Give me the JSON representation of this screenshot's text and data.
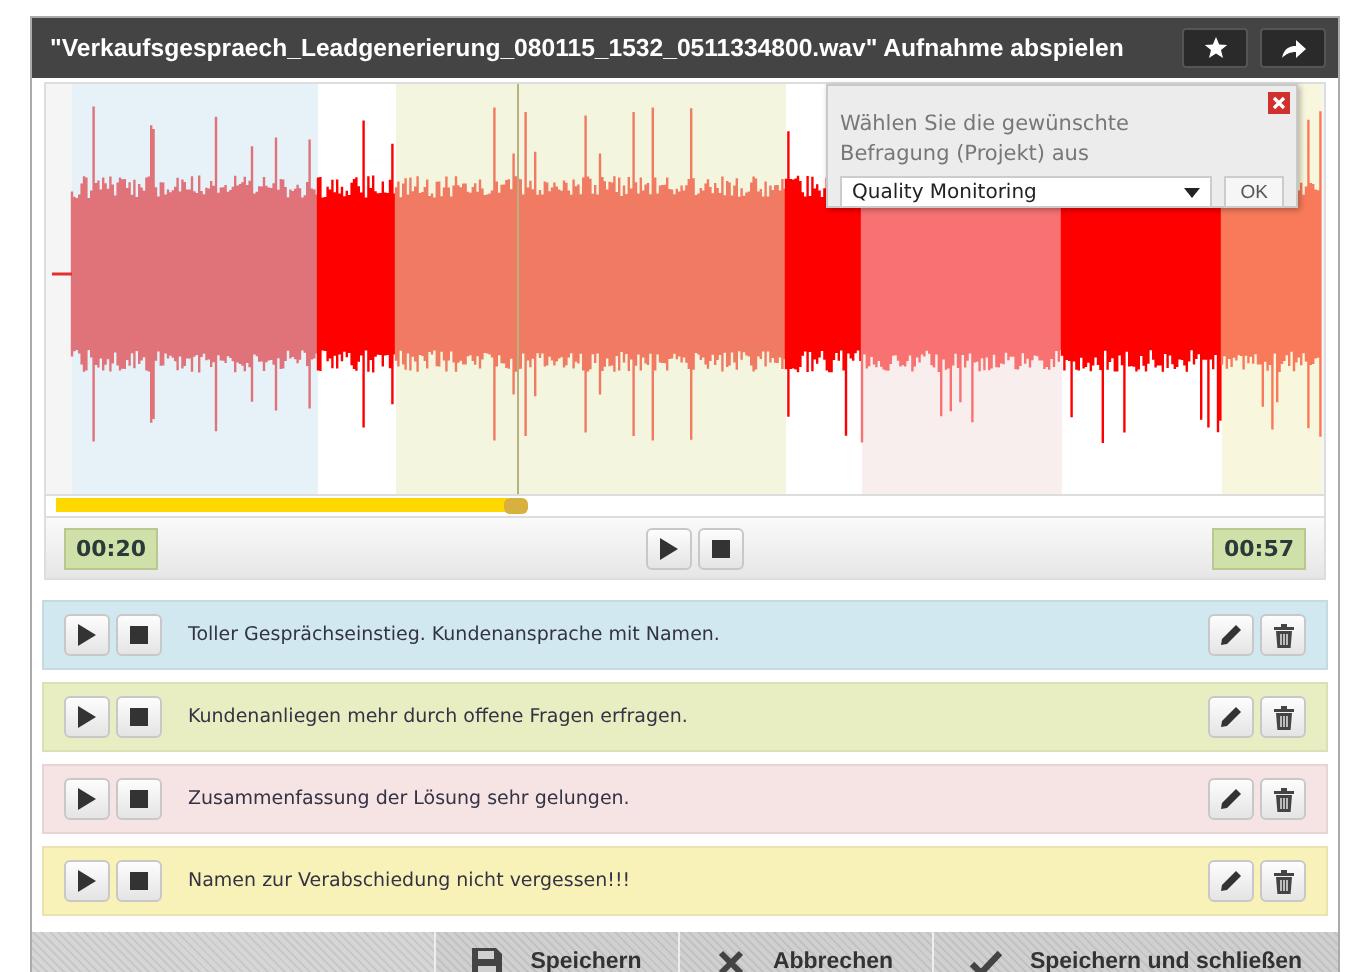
{
  "window": {
    "title": "\"Verkaufsgespraech_Leadgenerierung_080115_1532_0511334800.wav\" Aufnahme abspielen"
  },
  "popup": {
    "prompt": "Wählen Sie die gewünschte Befragung (Projekt) aus",
    "value": "Quality Monitoring",
    "ok": "OK"
  },
  "player": {
    "level": 0.36,
    "elapsed": "00:20",
    "total": "00:57"
  },
  "comments": [
    {
      "text": "Toller Gesprächseinstieg. Kundenansprache mit Namen.",
      "color": "#d2e8f0"
    },
    {
      "text": "Kundenanliegen mehr durch offene Fragen erfragen.",
      "color": "#e9eec2"
    },
    {
      "text": "Zusammenfassung der Lösung sehr gelungen.",
      "color": "#f6e3e3"
    },
    {
      "text": "Namen zur Verabschiedung nicht vergessen!!!",
      "color": "#f8f2b8"
    }
  ],
  "footer": [
    {
      "kind": "save",
      "label": "Speichern"
    },
    {
      "kind": "cancel",
      "label": "Abbrechen"
    },
    {
      "kind": "save_close",
      "label": "Speichern und schließen"
    }
  ]
}
